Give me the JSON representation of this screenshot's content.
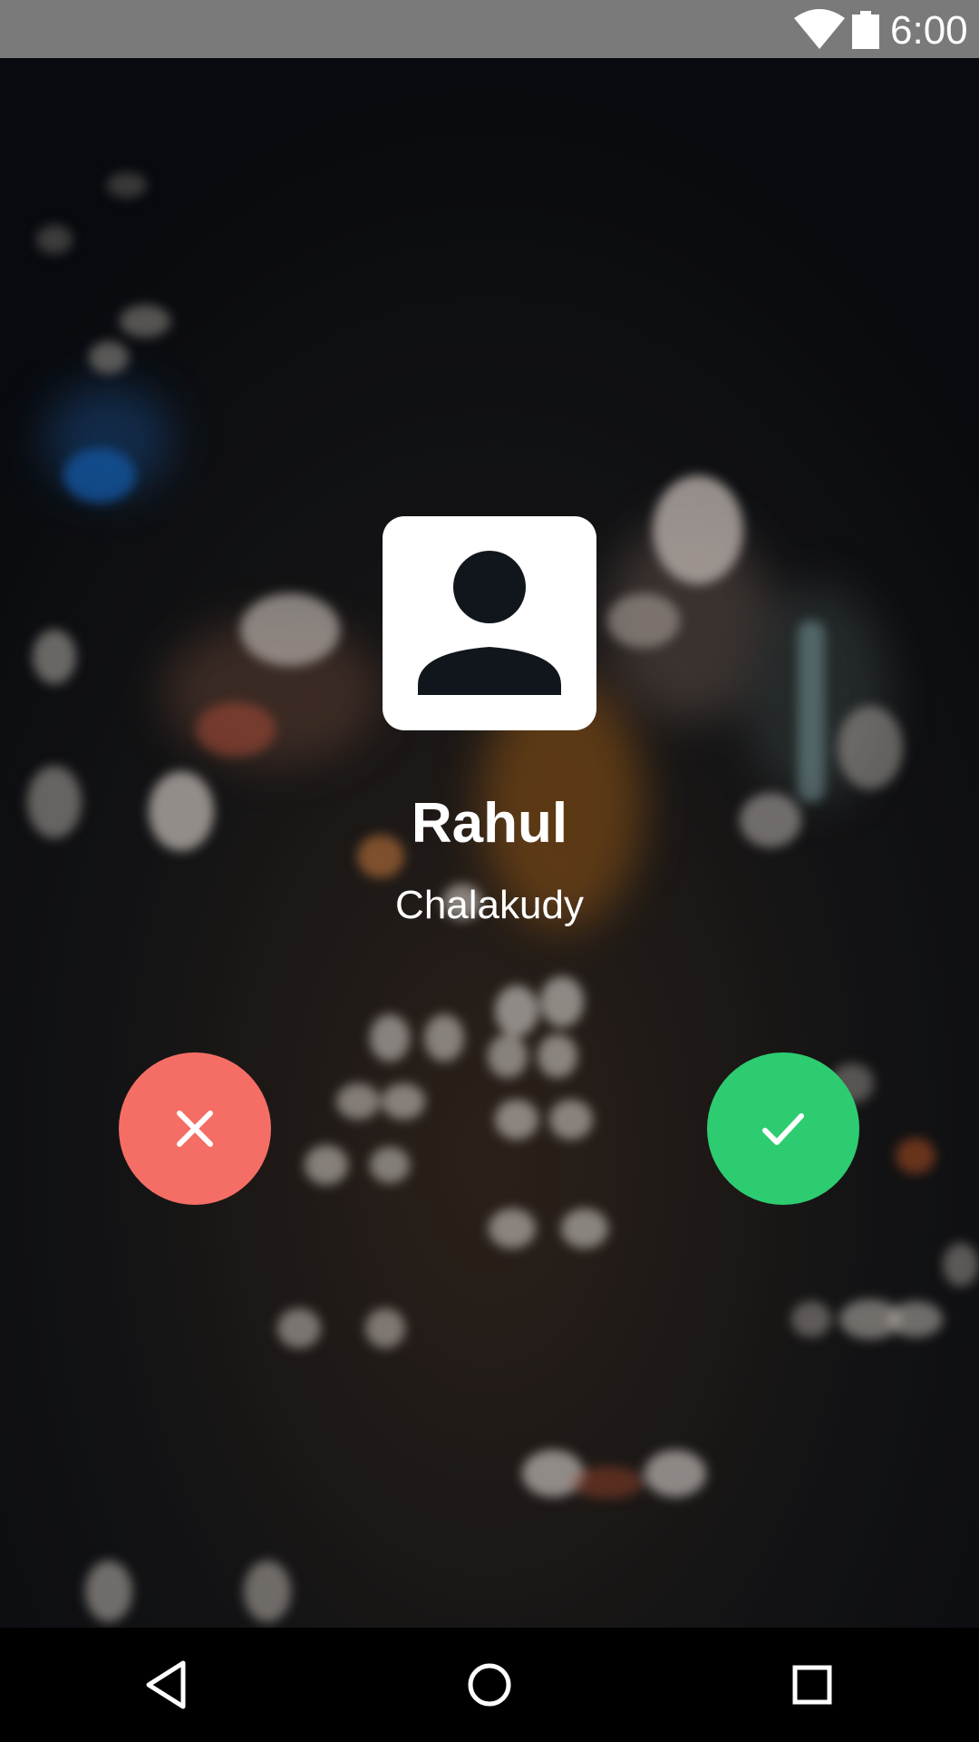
{
  "status_bar": {
    "time": "6:00",
    "icons": [
      "wifi-icon",
      "battery-icon"
    ]
  },
  "caller": {
    "name": "Rahul",
    "location": "Chalakudy",
    "avatar_icon": "person-icon"
  },
  "actions": {
    "decline_icon": "close-icon",
    "accept_icon": "check-icon"
  },
  "nav_bar": {
    "icons": [
      "back-icon",
      "home-icon",
      "recents-icon"
    ]
  },
  "colors": {
    "decline": "#f56e65",
    "accept": "#2ecc71",
    "status_bar": "#7a7a7a",
    "background": "#0d1117"
  }
}
